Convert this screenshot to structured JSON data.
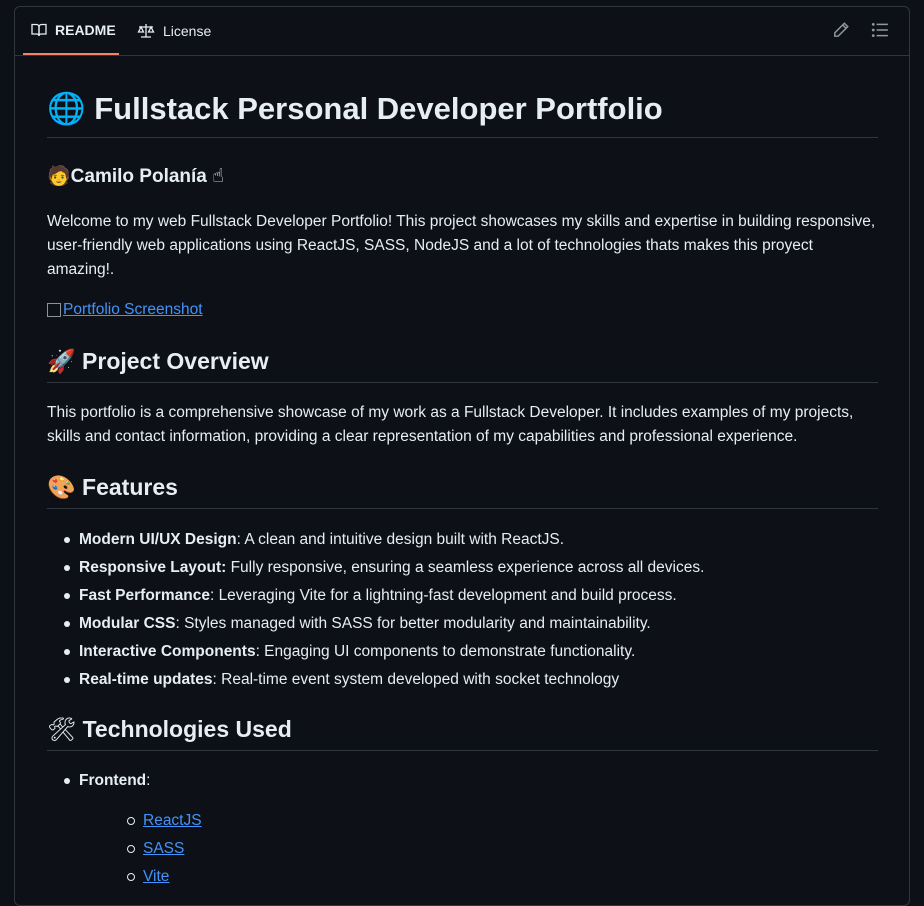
{
  "tabs": {
    "readme_label": "README",
    "license_label": "License"
  },
  "toolbar": {
    "edit_icon": "pencil-icon",
    "outline_icon": "list-unordered-icon"
  },
  "readme": {
    "title_emoji": "🌐",
    "title": "Fullstack Personal Developer Portfolio",
    "author_emoji": "🧑",
    "author": "Camilo Polanía",
    "author_emoji_after": "☝",
    "intro": "Welcome to my web Fullstack Developer Portfolio! This project showcases my skills and expertise in building responsive, user-friendly web applications using ReactJS, SASS, NodeJS and a lot of technologies thats makes this proyect amazing!.",
    "screenshot_alt": "Portfolio Screenshot",
    "overview_emoji": "🚀",
    "overview_heading": "Project Overview",
    "overview_text": "This portfolio is a comprehensive showcase of my work as a Fullstack Developer. It includes examples of my projects, skills and contact information, providing a clear representation of my capabilities and professional experience.",
    "features_emoji": "🎨",
    "features_heading": "Features",
    "features": [
      {
        "name": "Modern UI/UX Design",
        "desc": ": A clean and intuitive design built with ReactJS."
      },
      {
        "name": "Responsive Layout:",
        "desc": " Fully responsive, ensuring a seamless experience across all devices."
      },
      {
        "name": "Fast Performance",
        "desc": ": Leveraging Vite for a lightning-fast development and build process."
      },
      {
        "name": "Modular CSS",
        "desc": ": Styles managed with SASS for better modularity and maintainability."
      },
      {
        "name": "Interactive Components",
        "desc": ": Engaging UI components to demonstrate functionality."
      },
      {
        "name": "Real-time updates",
        "desc": ": Real-time event system developed with socket technology"
      }
    ],
    "tech_emoji": "🛠",
    "tech_heading": "Technologies Used",
    "tech_frontend_label": "Frontend",
    "tech_frontend_colon": ":",
    "tech_frontend_items": [
      "ReactJS",
      "SASS",
      "Vite"
    ]
  },
  "colors": {
    "background": "#0d1117",
    "text": "#e6edf3",
    "link": "#4493f8",
    "border": "#30363d",
    "active_tab_underline": "#f78166"
  }
}
